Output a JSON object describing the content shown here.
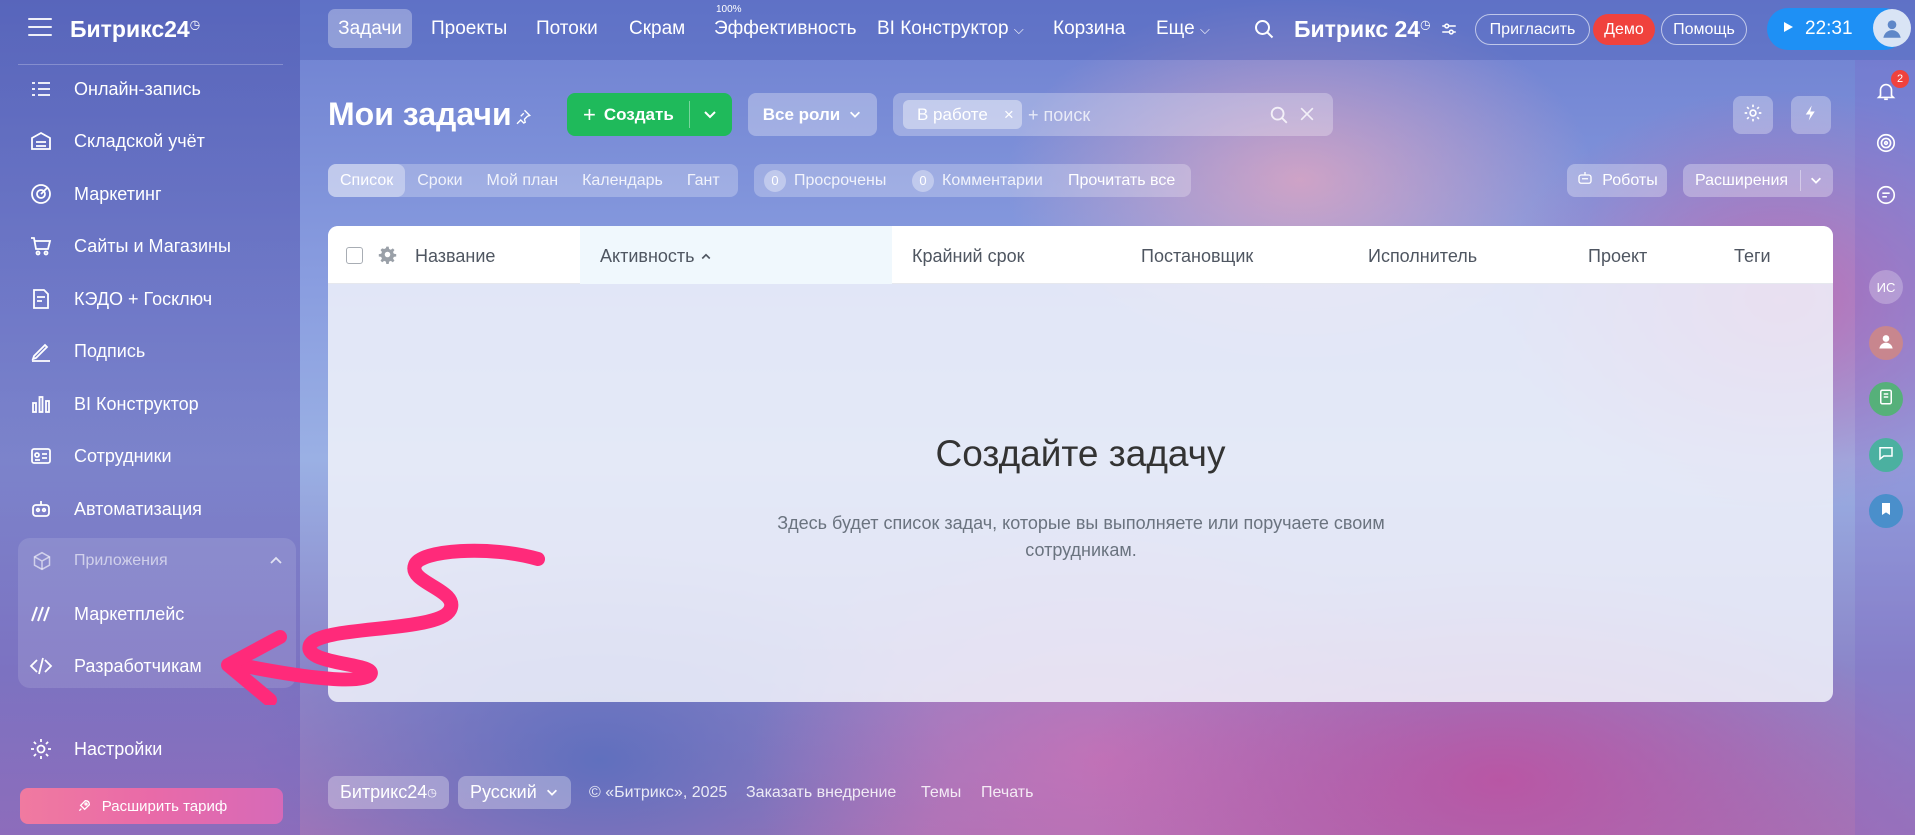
{
  "sidebar": {
    "logo": "Битрикс24",
    "logo_mark": "◷",
    "items": [
      {
        "label": "Онлайн-запись",
        "icon": "calendar-list-icon"
      },
      {
        "label": "Складской учёт",
        "icon": "warehouse-icon"
      },
      {
        "label": "Маркетинг",
        "icon": "target-icon"
      },
      {
        "label": "Сайты и Магазины",
        "icon": "cart-icon"
      },
      {
        "label": "КЭДО + Госключ",
        "icon": "document-sign-icon"
      },
      {
        "label": "Подпись",
        "icon": "signature-pen-icon"
      },
      {
        "label": "BI Конструктор",
        "icon": "bar-chart-icon"
      },
      {
        "label": "Сотрудники",
        "icon": "id-card-icon"
      },
      {
        "label": "Автоматизация",
        "icon": "robot-icon"
      }
    ],
    "apps_group": {
      "label": "Приложения",
      "items": [
        {
          "label": "Маркетплейс",
          "icon": "marketplace-icon"
        },
        {
          "label": "Разработчикам",
          "icon": "code-icon"
        }
      ]
    },
    "settings_label": "Настройки",
    "upgrade_label": "Расширить тариф"
  },
  "topbar": {
    "nav": [
      "Задачи",
      "Проекты",
      "Потоки",
      "Скрам",
      "Эффективность",
      "BI Конструктор",
      "Корзина",
      "Еще"
    ],
    "efficiency_badge": "100%",
    "brand": "Битрикс 24",
    "invite_label": "Пригласить",
    "demo_label": "Демо",
    "help_label": "Помощь",
    "time": "22:31"
  },
  "rail": {
    "notifications_count": "2",
    "user_initials": "ИС"
  },
  "main": {
    "title": "Мои задачи",
    "create_label": "Создать",
    "roles_label": "Все роли",
    "filter_chip": "В работе",
    "search_placeholder": "+ поиск",
    "views": [
      "Список",
      "Сроки",
      "Мой план",
      "Календарь",
      "Гант"
    ],
    "counters": {
      "overdue_num": "0",
      "overdue_label": "Просрочены",
      "comments_num": "0",
      "comments_label": "Комментарии",
      "read_all": "Прочитать все"
    },
    "robots_label": "Роботы",
    "extensions_label": "Расширения",
    "columns": [
      "Название",
      "Активность",
      "Крайний срок",
      "Постановщик",
      "Исполнитель",
      "Проект",
      "Теги"
    ],
    "empty_title": "Создайте задачу",
    "empty_text": "Здесь будет список задач, которые вы выполняете или поручаете своим сотрудникам."
  },
  "footer": {
    "brand": "Битрикс24",
    "brand_mark": "◷",
    "language": "Русский",
    "copyright": "© «Битрикс», 2025",
    "links": [
      "Заказать внедрение",
      "Темы",
      "Печать"
    ]
  },
  "colors": {
    "accent_green": "#1fba5b",
    "time_blue": "#1e90f5",
    "demo_red": "#f0423d",
    "annotation_pink": "#ff2a7a"
  }
}
